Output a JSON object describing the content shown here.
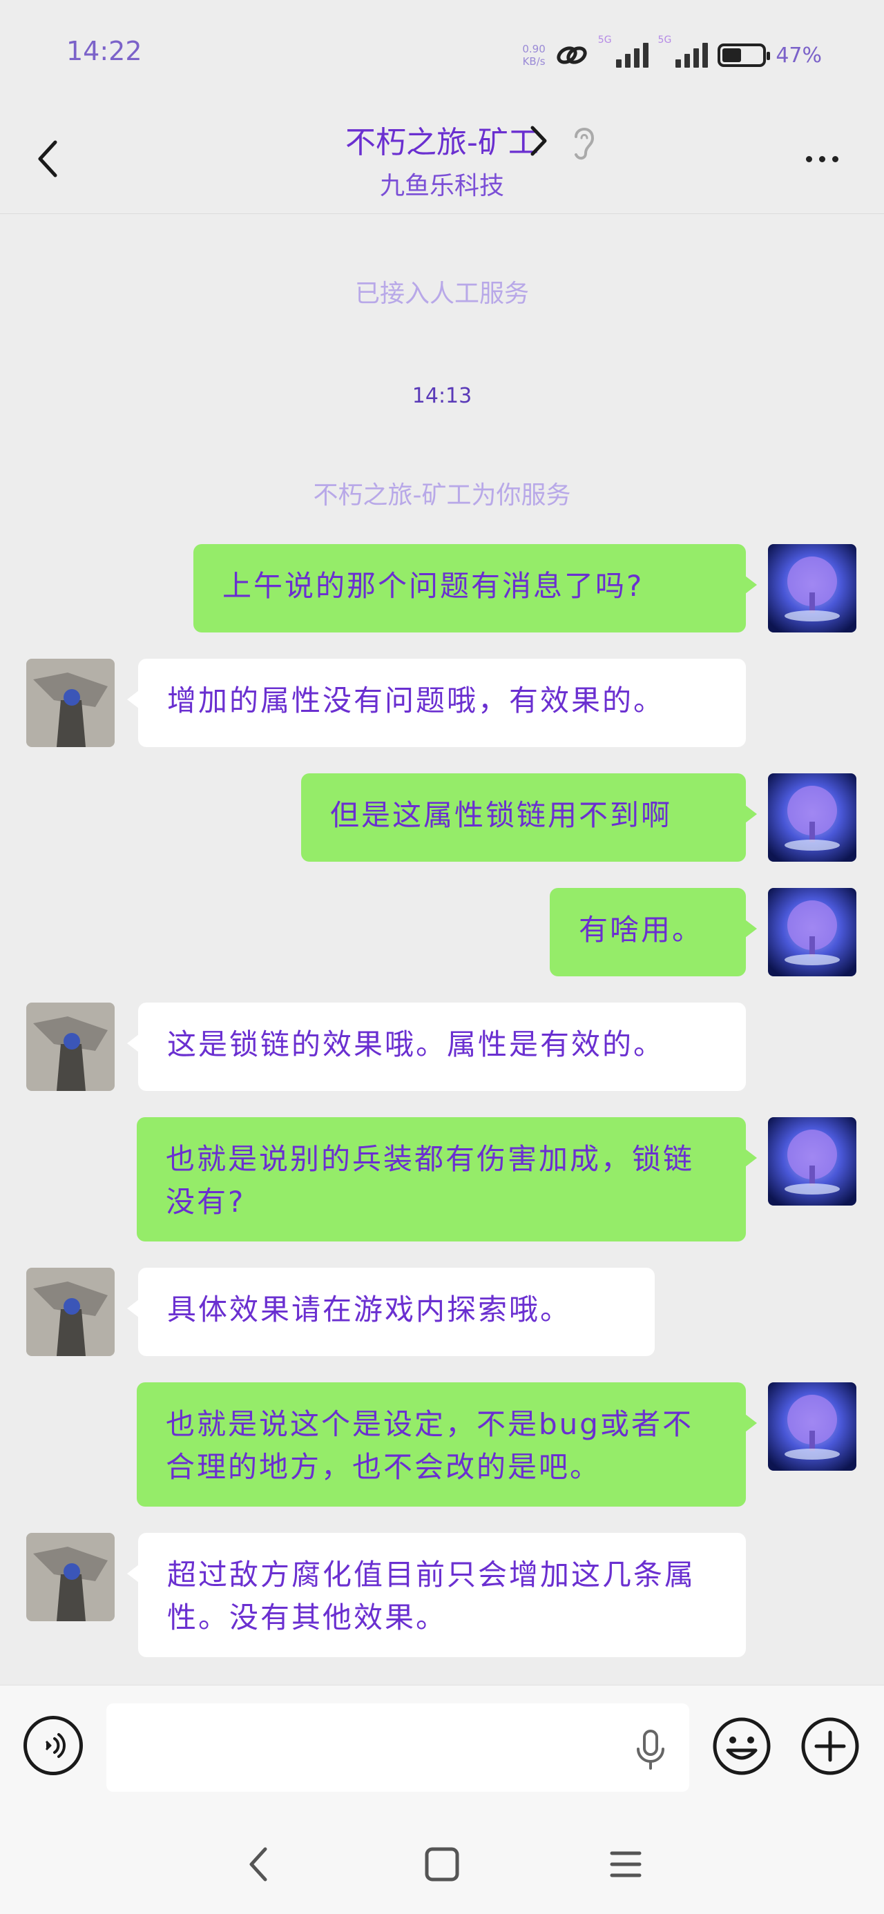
{
  "status": {
    "time": "14:22",
    "net_speed_value": "0.90",
    "net_speed_unit": "KB/s",
    "network_1": "5G",
    "network_2": "5G",
    "battery_level": 0.47,
    "battery": "47%"
  },
  "header": {
    "title": "不朽之旅-矿工",
    "subtitle": "九鱼乐科技"
  },
  "system": {
    "joined": "已接入人工服务",
    "time": "14:13",
    "serving": "不朽之旅-矿工为你服务"
  },
  "messages": [
    {
      "side": "right",
      "text": "上午说的那个问题有消息了吗?"
    },
    {
      "side": "left",
      "text": "增加的属性没有问题哦，有效果的。"
    },
    {
      "side": "right",
      "text": "但是这属性锁链用不到啊"
    },
    {
      "side": "right",
      "text": "有啥用。"
    },
    {
      "side": "left",
      "text": "这是锁链的效果哦。属性是有效的。"
    },
    {
      "side": "right",
      "text": "也就是说别的兵装都有伤害加成，锁链没有?"
    },
    {
      "side": "left",
      "text": "具体效果请在游戏内探索哦。"
    },
    {
      "side": "right",
      "text": "也就是说这个是设定，不是bug或者不合理的地方，也不会改的是吧。"
    },
    {
      "side": "left",
      "text": "超过敌方腐化值目前只会增加这几条属性。没有其他效果。"
    }
  ],
  "input": {
    "placeholder": ""
  },
  "colors": {
    "self_bubble": "#95ec69",
    "other_bubble": "#ffffff",
    "text_purple": "#6a2fd0",
    "background": "#ededed"
  }
}
